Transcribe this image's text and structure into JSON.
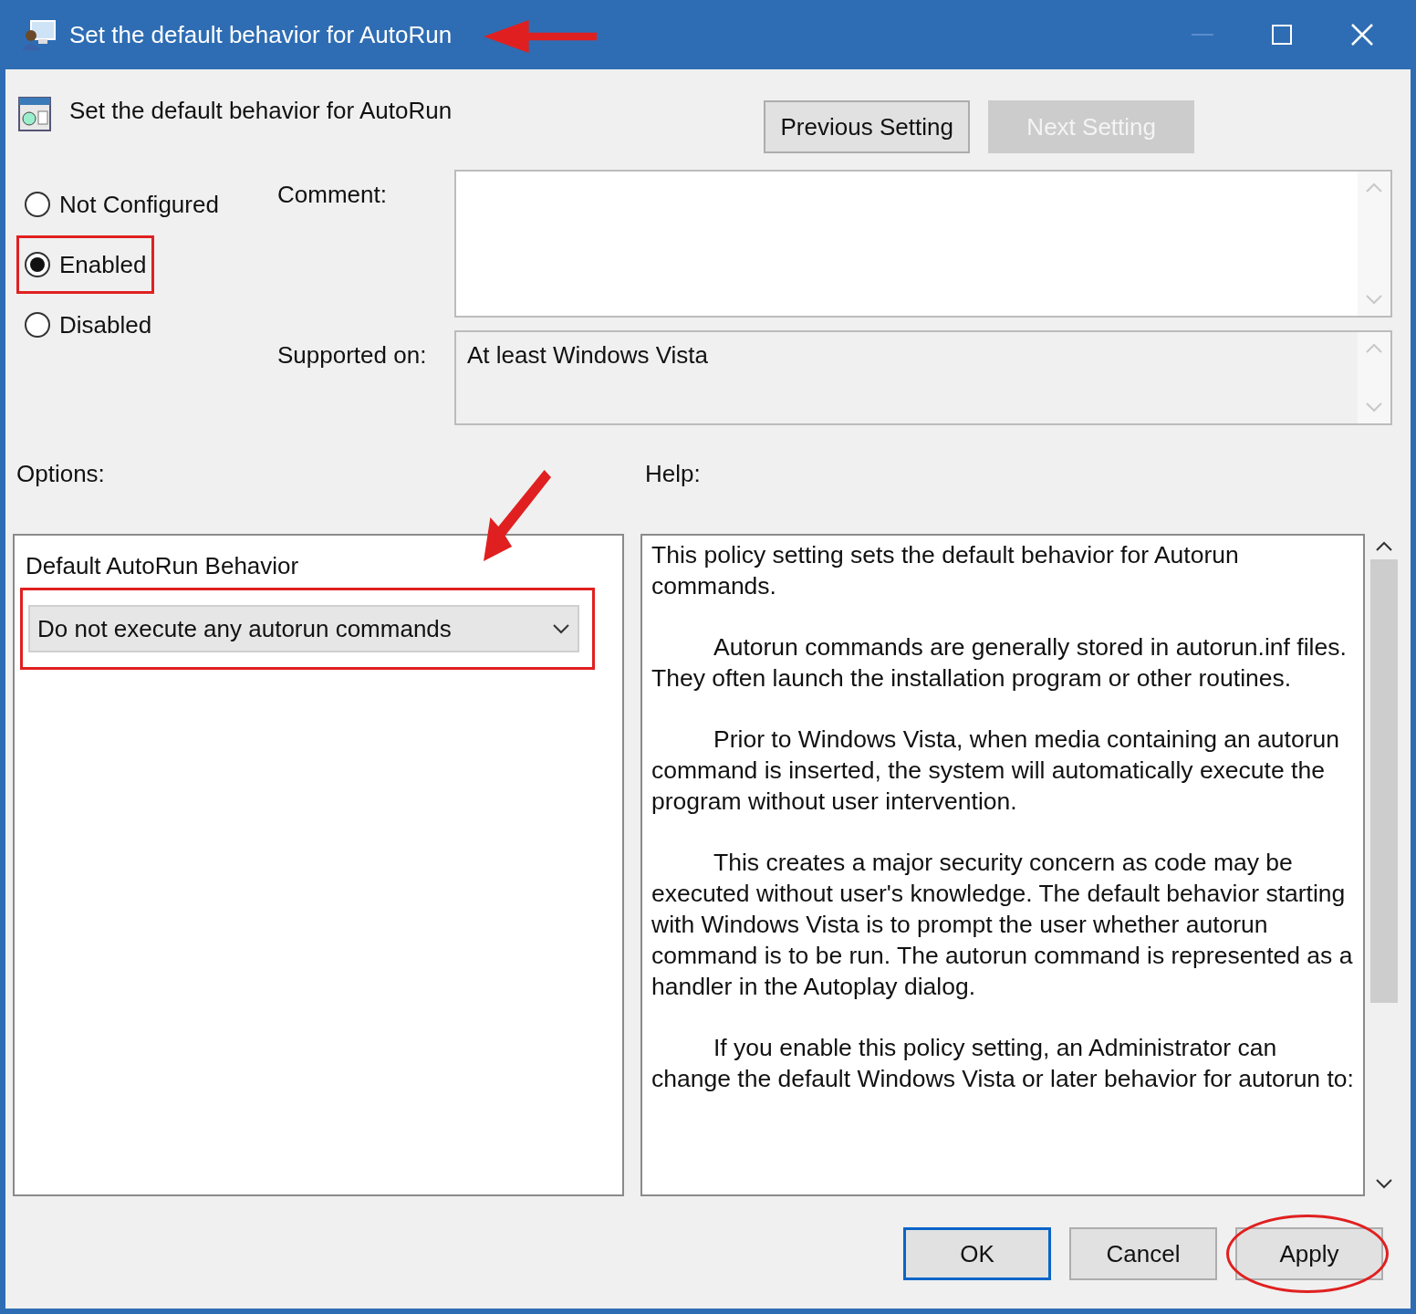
{
  "window": {
    "title": "Set the default behavior for AutoRun",
    "title_arrow": true
  },
  "header": {
    "title": "Set the default behavior for AutoRun"
  },
  "nav_buttons": [
    {
      "label": "Previous Setting",
      "disabled": false
    },
    {
      "label": "Next Setting",
      "disabled": true
    }
  ],
  "states": [
    {
      "label": "Not Configured",
      "selected": false,
      "highlight": false
    },
    {
      "label": "Enabled",
      "selected": true,
      "highlight": true
    },
    {
      "label": "Disabled",
      "selected": false,
      "highlight": false
    }
  ],
  "comment": {
    "label": "Comment:"
  },
  "supported_on": {
    "label": "Supported on:",
    "value": "At least Windows Vista"
  },
  "options": {
    "label": "Options:",
    "field_label": "Default AutoRun Behavior",
    "dropdown_value": "Do not execute any autorun commands",
    "highlight": true,
    "arrow": true
  },
  "help": {
    "label": "Help:",
    "paragraphs": [
      {
        "text": "This policy setting sets the default behavior for Autorun commands.",
        "indented": false
      },
      {
        "text": "Autorun commands are generally stored in autorun.inf files. They often launch the installation program or other routines.",
        "indented": true
      },
      {
        "text": "Prior to Windows Vista, when media containing an autorun command is inserted, the system will automatically execute the program without user intervention.",
        "indented": true
      },
      {
        "text": "This creates a major security concern as code may be executed without user's knowledge. The default behavior starting with Windows Vista is to prompt the user whether autorun command is to be run. The autorun command is represented as a handler in the Autoplay dialog.",
        "indented": true
      },
      {
        "text": "If you enable this policy setting, an Administrator can change the default Windows Vista or later behavior for autorun to:",
        "indented": true
      }
    ]
  },
  "buttons": [
    {
      "label": "OK",
      "default": true,
      "highlight": false
    },
    {
      "label": "Cancel",
      "default": false,
      "highlight": false
    },
    {
      "label": "Apply",
      "default": false,
      "highlight": true
    }
  ]
}
